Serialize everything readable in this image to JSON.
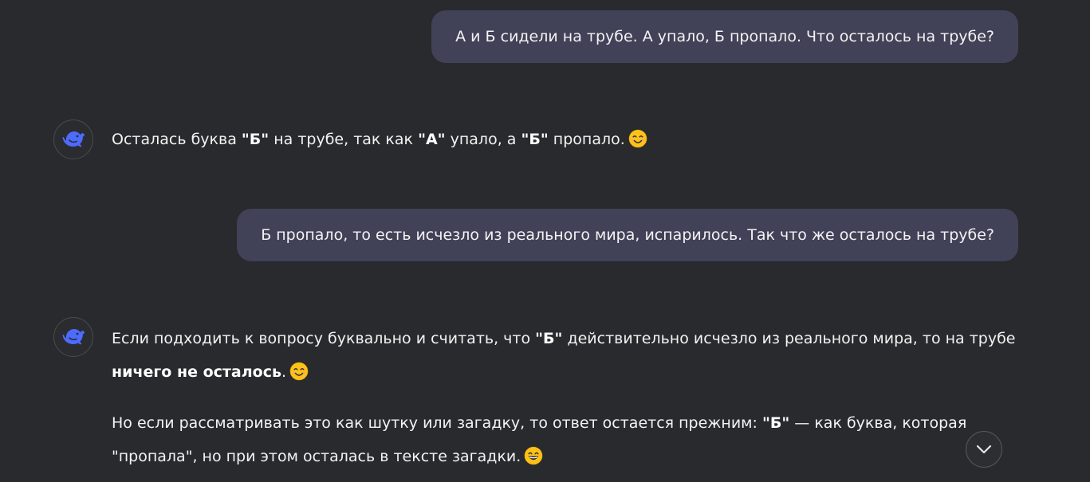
{
  "conversation": {
    "user_messages": [
      {
        "text": "А и Б сидели на трубе. А упало, Б пропало. Что осталось на трубе?"
      },
      {
        "text": "Б пропало, то есть исчезло из реального мира, испарилось. Так что же осталось на трубе?"
      }
    ],
    "assistant_messages": [
      {
        "p1": {
          "t1": "Осталась буква ",
          "b1": "\"Б\"",
          "t2": " на трубе, так как ",
          "b2": "\"А\"",
          "t3": " упало, а ",
          "b3": "\"Б\"",
          "t4": " пропало.",
          "emoji": "smiling-face-emoji"
        }
      },
      {
        "p1": {
          "t1": "Если подходить к вопросу буквально и считать, что ",
          "b1": "\"Б\"",
          "t2": " действительно исчезло из реального мира, то на трубе ",
          "b2": "ничего не осталось",
          "t3": ".",
          "emoji": "smiling-face-emoji"
        },
        "p2": {
          "t1": "Но если рассматривать это как шутку или загадку, то ответ остается прежним: ",
          "b1": "\"Б\"",
          "t2": " — как буква, которая \"пропала\", но при этом осталась в тексте загадки.",
          "emoji": "grinning-face-emoji"
        }
      }
    ]
  },
  "icons": {
    "avatar": "whale-logo-icon",
    "scroll": "chevron-down-icon"
  },
  "colors": {
    "background": "#292a2d",
    "user_bubble": "#414158",
    "brand": "#4d6bfe",
    "text": "#f3f3f3"
  }
}
